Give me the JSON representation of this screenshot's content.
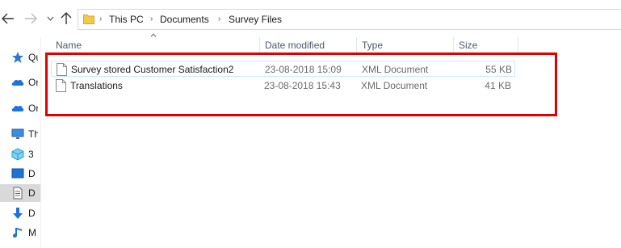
{
  "address": {
    "crumbs": [
      "This PC",
      "Documents",
      "Survey Files"
    ]
  },
  "nav_pane": {
    "items": [
      {
        "label": "Qu",
        "icon": "star-icon"
      },
      {
        "label": "On",
        "icon": "cloud-icon"
      },
      {
        "label": "On",
        "icon": "cloud-icon"
      },
      {
        "label": "Th",
        "icon": "monitor-icon"
      },
      {
        "label": "3",
        "icon": "cube-3d-icon"
      },
      {
        "label": "D",
        "icon": "desktop-icon"
      },
      {
        "label": "D",
        "icon": "document-icon"
      },
      {
        "label": "D",
        "icon": "download-icon"
      },
      {
        "label": "M",
        "icon": "music-icon"
      }
    ]
  },
  "columns": {
    "name": "Name",
    "date": "Date modified",
    "type": "Type",
    "size": "Size"
  },
  "files": [
    {
      "name": "Survey stored Customer Satisfaction2",
      "date": "23-08-2018 15:09",
      "type": "XML Document",
      "size": "55 KB"
    },
    {
      "name": "Translations",
      "date": "23-08-2018 15:43",
      "type": "XML Document",
      "size": "41 KB"
    }
  ],
  "colors": {
    "annotation": "#e00000",
    "hover_border": "#cde8ff",
    "folder": "#f2c94c"
  }
}
